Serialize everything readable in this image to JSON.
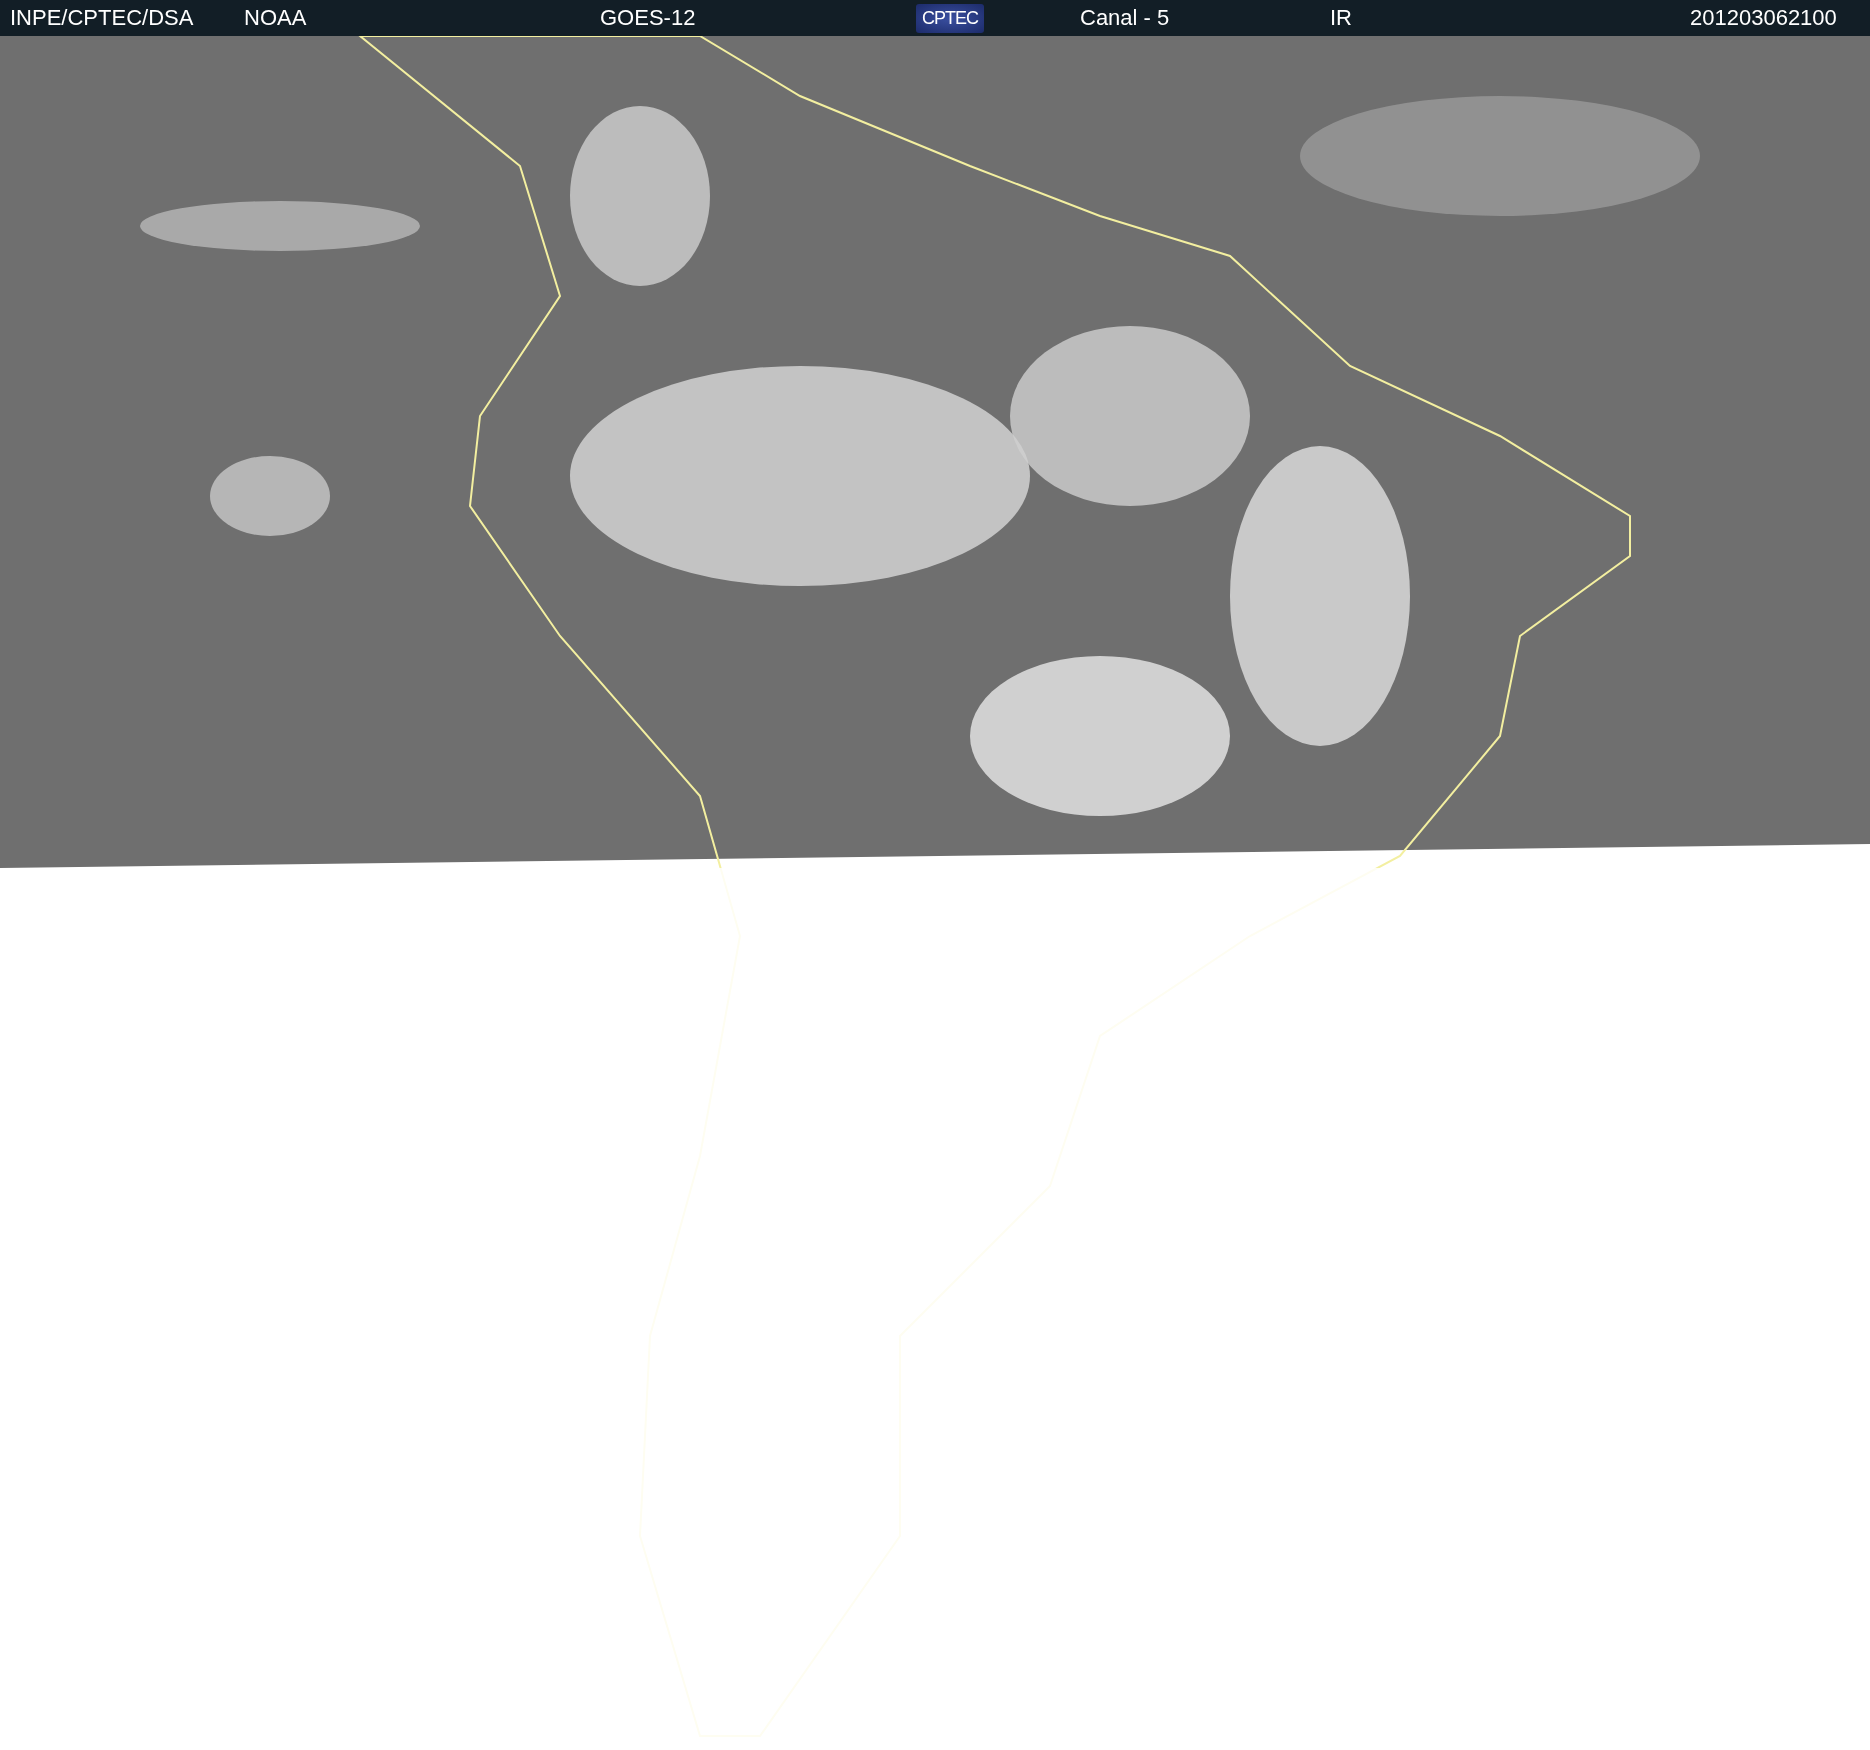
{
  "header": {
    "items": [
      {
        "kind": "text",
        "text": "INPE/CPTEC/DSA"
      },
      {
        "kind": "text",
        "text": "NOAA"
      },
      {
        "kind": "text",
        "text": "GOES-12"
      },
      {
        "kind": "logo",
        "text": "CPTEC"
      },
      {
        "kind": "text",
        "text": "Canal - 5"
      },
      {
        "kind": "text",
        "text": "IR"
      },
      {
        "kind": "text",
        "text": "201203062100"
      }
    ]
  }
}
